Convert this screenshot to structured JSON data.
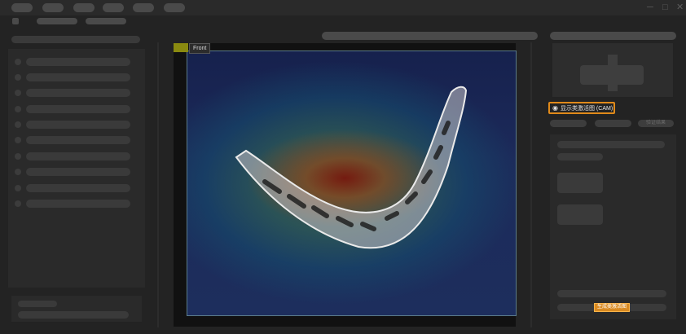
{
  "window": {
    "minimize": "─",
    "maximize": "□",
    "close": "✕"
  },
  "viewer": {
    "tag_color": "#8a8a10",
    "view_label": "Front"
  },
  "right_panel": {
    "cam_toggle_label": "显示类激活图 (CAM)",
    "tab_right_label": "验证结果",
    "generate_button_label": "生成类激活图"
  },
  "colors": {
    "accent": "#e08a1a",
    "background": "#232323",
    "panel": "#2a2a2a"
  }
}
